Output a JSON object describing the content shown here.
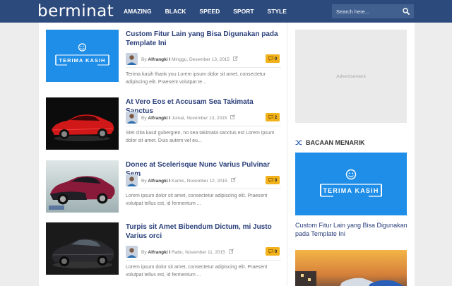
{
  "header": {
    "logo": "berminat",
    "nav": [
      "AMAZING",
      "BLACK",
      "SPEED",
      "SPORT",
      "STYLE"
    ],
    "search_placeholder": "Search here..."
  },
  "posts": [
    {
      "title": "Custom Fitur Lain yang Bisa Digunakan pada Template Ini",
      "author": "Alfrangki I",
      "date": "Minggu, Desember 13, 2015",
      "comments": "0",
      "excerpt": "Terima kasih thank you Lorem ipsum dolor sit amet, consectetur adipiscing elit. Praesent volutpat te...",
      "thumb": "terima-kasih",
      "thumb_text": "TERIMA KASIH"
    },
    {
      "title": "At Vero Eos et Accusam Sea Takimata Sanctus",
      "author": "Alfrangki I",
      "date": "Jumat, November 13, 2015",
      "comments": "2",
      "excerpt": "Stet clita kasd gubergren, no sea takimata sanctus est Lorem ipsum dolor sit amet. Duis autem vel eu...",
      "thumb": "red-car"
    },
    {
      "title": "Donec at Scelerisque Nunc Varius Pulvinar Sem",
      "author": "Alfrangki I",
      "date": "Kamis, November 12, 2015",
      "comments": "0",
      "excerpt": "Lorem ipsum dolor sit amet, consectetur adipiscing elit. Praesent volutpat tellus est, id fermentum ...",
      "thumb": "pink-car"
    },
    {
      "title": "Turpis sit Amet Bibendum Dictum, mi Justo Varius orci",
      "author": "Alfrangki I",
      "date": "Rabu, November 11, 2015",
      "comments": "0",
      "excerpt": "Lorem ipsum dolor sit amet, consectetur adipiscing elit. Praesent volutpat tellus est, id fermentum ...",
      "thumb": "black-car"
    }
  ],
  "sidebar": {
    "ad_label": "Advertisement",
    "widget_title": "BACAAN MENARIK",
    "featured_title": "Custom Fitur Lain yang Bisa Digunakan pada Template Ini",
    "featured_thumb_text": "TERIMA KASIH"
  },
  "colors": {
    "header_bg": "#2d4a7c",
    "accent_blue": "#1f8ee8",
    "title_blue": "#2a3f7a",
    "comment_badge": "#f2b21b"
  },
  "icons": {
    "search": "search-icon",
    "edit": "edit-icon",
    "comment": "comment-icon",
    "shuffle": "shuffle-icon",
    "smiley": "smiley-icon"
  }
}
